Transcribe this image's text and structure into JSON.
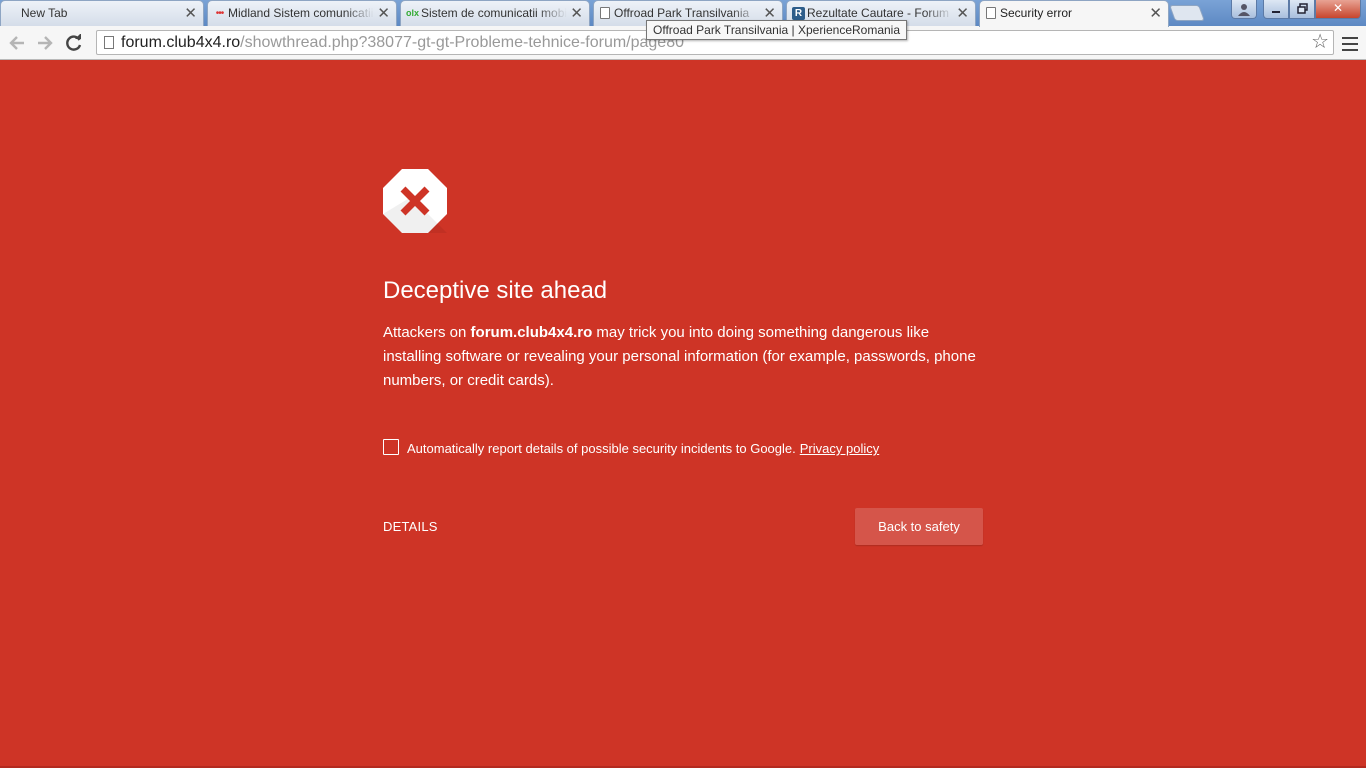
{
  "browser": {
    "tabs": [
      {
        "title": "New Tab",
        "icon": "none",
        "active": false
      },
      {
        "title": "Midland Sistem comunicatii",
        "icon": "dots-icon",
        "active": false
      },
      {
        "title": "Sistem de comunicatii mobil",
        "icon": "olx-icon",
        "active": false
      },
      {
        "title": "Offroad Park Transilvania",
        "icon": "page-icon",
        "active": false
      },
      {
        "title": "Rezultate Cautare - Forum",
        "icon": "r-logo-icon",
        "active": false
      },
      {
        "title": "Security error",
        "icon": "page-icon",
        "active": true
      }
    ],
    "tab_close_glyph": "✕",
    "tooltip": "Offroad Park Transilvania | XperienceRomania",
    "url_host": "forum.club4x4.ro",
    "url_path": "/showthread.php?38077-gt-gt-Probleme-tehnice-forum/page80",
    "window_close_glyph": "✕"
  },
  "interstitial": {
    "heading": "Deceptive site ahead",
    "desc_before": "Attackers on ",
    "desc_host": "forum.club4x4.ro",
    "desc_after": " may trick you into doing something dangerous like installing software or revealing your personal information (for example, passwords, phone numbers, or credit cards).",
    "report_label": "Automatically report details of possible security incidents to Google.",
    "privacy_link": "Privacy policy",
    "details_label": "DETAILS",
    "safety_label": "Back to safety"
  },
  "colors": {
    "background": "#ce3426",
    "button": "#d5554a",
    "icon_x": "#ce3426"
  }
}
